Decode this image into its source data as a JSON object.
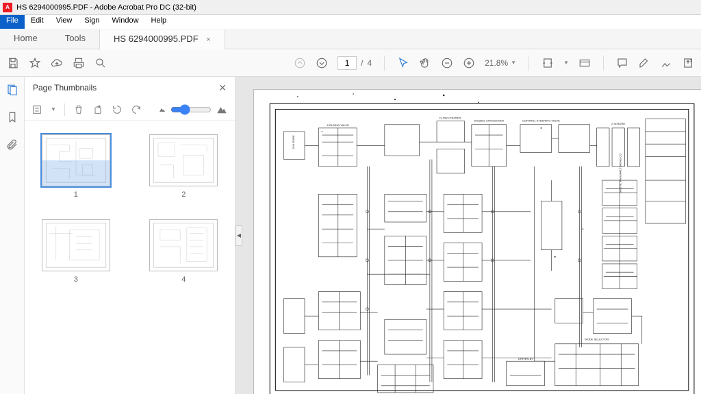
{
  "window": {
    "title": "HS 6294000995.PDF - Adobe Acrobat Pro DC (32-bit)",
    "app_icon": "A"
  },
  "menu": {
    "file": "File",
    "edit": "Edit",
    "view": "View",
    "sign": "Sign",
    "window": "Window",
    "help": "Help"
  },
  "tabs": {
    "home": "Home",
    "tools": "Tools",
    "doc": "HS 6294000995.PDF",
    "close": "×"
  },
  "toolbar": {
    "page_current": "1",
    "page_sep": "/",
    "page_total": "4",
    "zoom": "21.8%"
  },
  "thumbpanel": {
    "title": "Page Thumbnails",
    "pages": [
      "1",
      "2",
      "3",
      "4"
    ]
  }
}
